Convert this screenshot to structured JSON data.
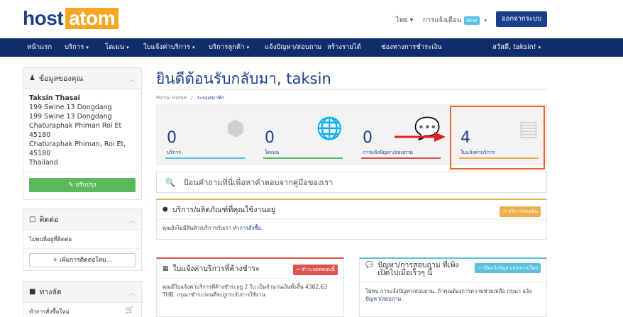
{
  "header": {
    "logo_left": "host",
    "logo_right": "atom",
    "language": "ไทย ▾",
    "notifications": "การแจ้งเตือน",
    "new_badge": "NEW",
    "logout": "ออกจากระบบ"
  },
  "nav": {
    "items": [
      {
        "label": "หน้าแรก"
      },
      {
        "label": "บริการ"
      },
      {
        "label": "โดเมน"
      },
      {
        "label": "ใบแจ้งค่าบริการ"
      },
      {
        "label": "บริการลูกค้า"
      },
      {
        "label": "แจ้งปัญหา/สอบถาม"
      },
      {
        "label": "สร้างรายได้"
      },
      {
        "label": "ช่องทางการชำระเงิน"
      }
    ],
    "user": "สวัสดี, taksin!"
  },
  "sidebar": {
    "info_title": "ข้อมูลของคุณ",
    "name": "Taksin Thasai",
    "address_lines": [
      "199 Swine 13 Dongdang",
      "199 Swine 13 Dongdang",
      "Chaturaphak Phiman Roi Et",
      "45180",
      "Chaturaphak Phiman, Roi Et,",
      "45180",
      "Thailand"
    ],
    "update_button": "ปรับปรุง",
    "contact_title": "ติดต่อ",
    "contact_empty": "ไม่พบที่อยู่ที่ติดต่อ",
    "add_contact_button": "เพิ่มการติดต่อใหม่...",
    "shortcut_title": "ทางลัด",
    "shortcut_item": "ทำการสั่งซื้อใหม่"
  },
  "main": {
    "title": "ยินดีต้อนรับกลับมา, taksin",
    "breadcrumb_home": "Portal Home",
    "breadcrumb_sep": "/",
    "breadcrumb_current": "ระบบสมาชิก",
    "tiles": [
      {
        "value": "0",
        "label": "บริการ",
        "color": "#5bc0de",
        "icon": "cube-icon"
      },
      {
        "value": "0",
        "label": "โดเมน",
        "color": "#5cb85c",
        "icon": "globe-icon"
      },
      {
        "value": "0",
        "label": "การแจ้งปัญหา/สอบถาม",
        "color": "#d9534f",
        "icon": "comments-icon"
      },
      {
        "value": "4",
        "label": "ใบแจ้งค่าบริการ",
        "color": "#f0ad4e",
        "icon": "credit-card-icon"
      }
    ],
    "search_placeholder": "ป้อนคำถามที่นี่เพื่อหาคำตอบจากคู่มือของเรา",
    "services_card": {
      "title": "บริการ/ผลิตภัณฑ์ที่คุณใช้งานอยู่",
      "button": "→ บริการของฉัน",
      "body_text": "คุณยังไม่มีสินค้า/บริการกับเรา",
      "body_link": "ทำการสั่งซื้อ."
    },
    "invoices_card": {
      "title": "ใบแจ้งค่าบริการที่ค้างชำระ",
      "button": "→ ชำระยอดตอนนี้",
      "body_text": "คุณมีใบแจ้งค่าบริการที่ค้างชำระอยู่ 2 ใบ เป็นจำนวนเงินทั้งสิ้น 4382.63 THB. กรุณาชำระก่อนที่จะถูกระงับการใช้งาน"
    },
    "tickets_card": {
      "title": "ปัญหา/การสอบถาม ที่เพิ่งเปิดไปเมื่อเร็วๆ นี้",
      "button": "+ เปิดแจ้งปัญหา/สอบถามใหม่",
      "body_text": "ไม่พบ การแจ้งปัญหา/สอบถาม. ถ้าคุณต้องการความช่วยเหลือ กรุณา",
      "body_link": "แจ้งปัญหา/สอบถาม."
    }
  },
  "colors": {
    "brand_blue": "#1b3f8b",
    "nav_bg": "#0e2d6a",
    "logo_orange": "#f5a623",
    "highlight": "#f0622a"
  }
}
